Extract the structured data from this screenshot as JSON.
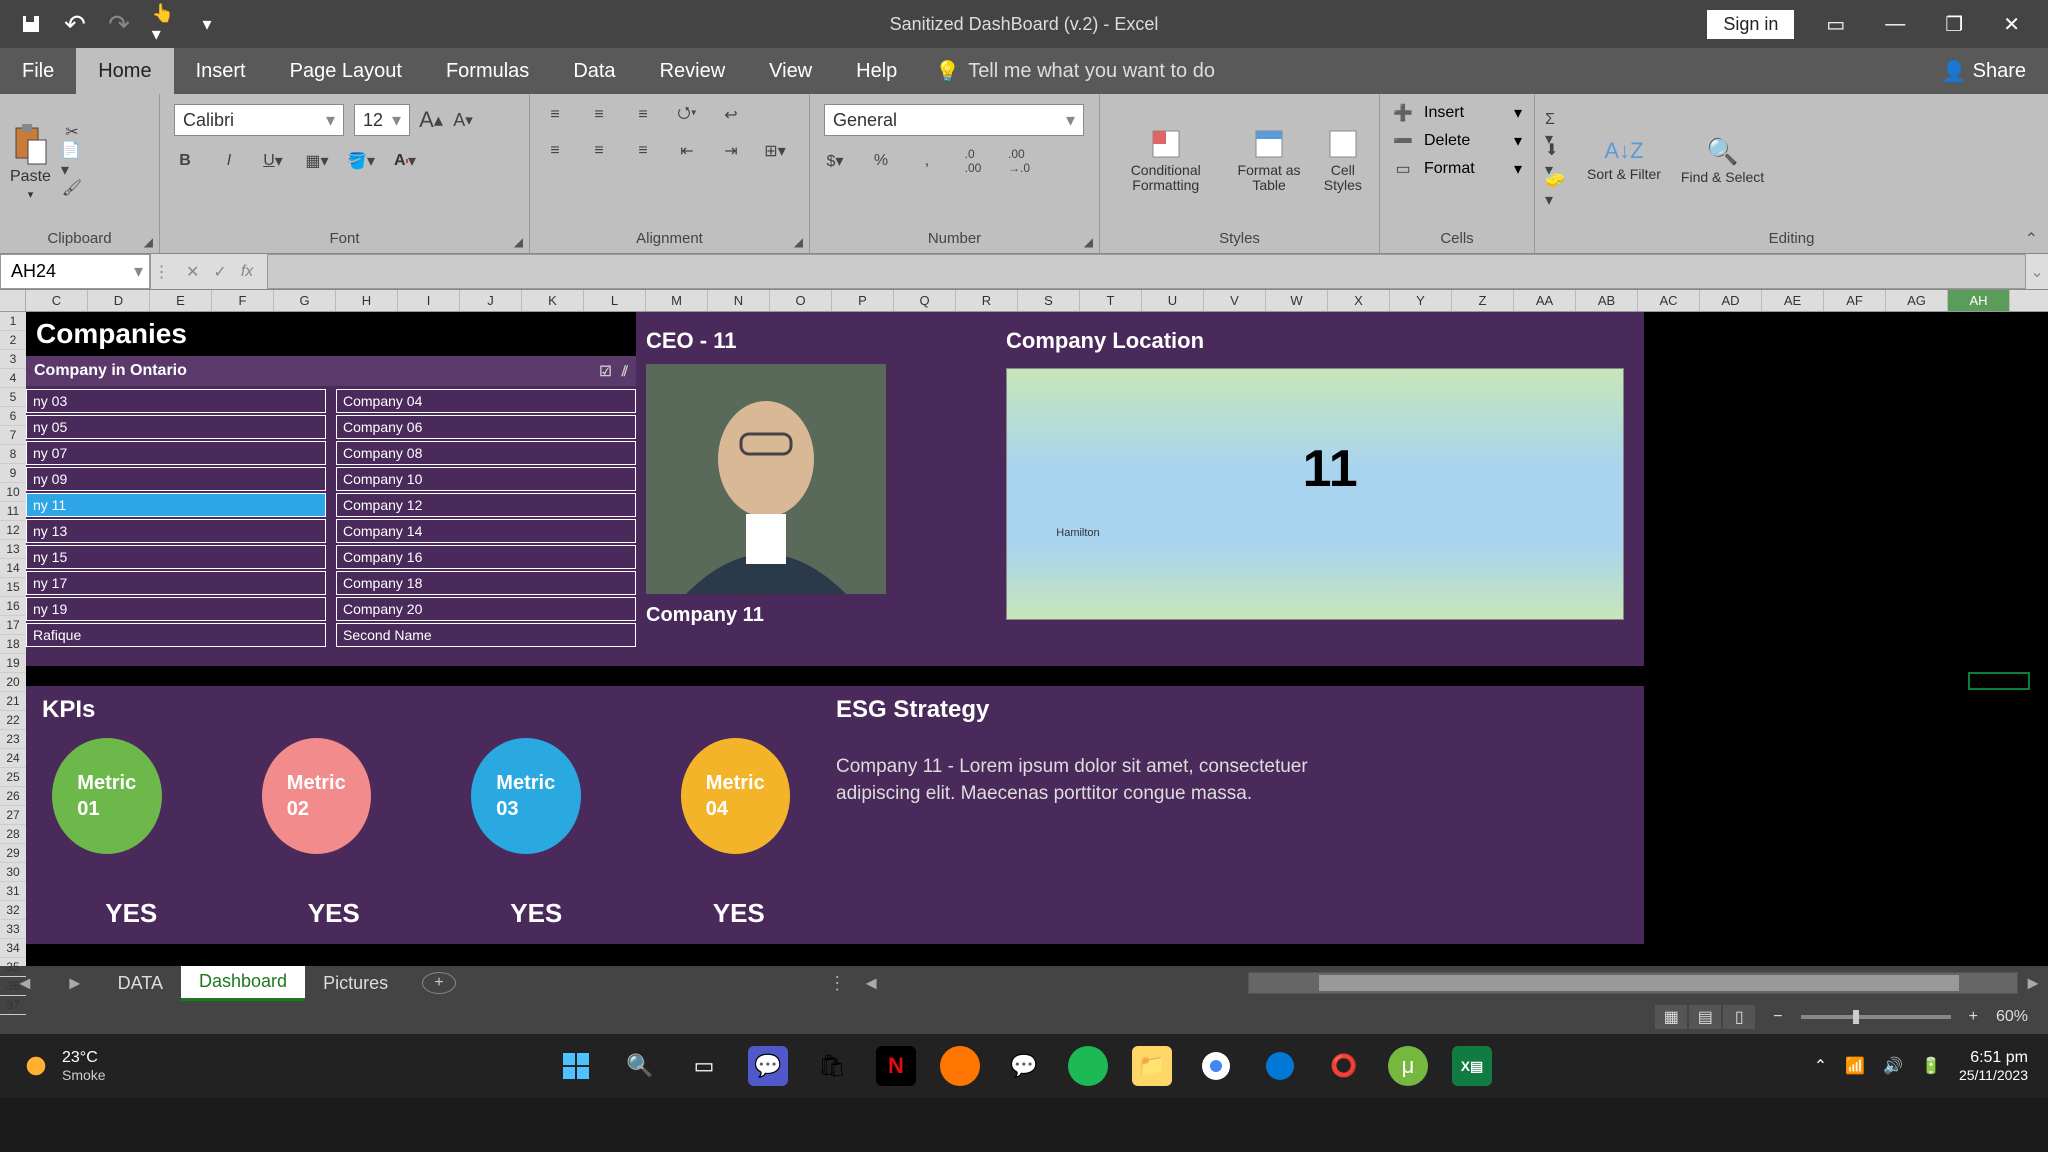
{
  "titlebar": {
    "title": "Sanitized DashBoard (v.2)  -  Excel",
    "signin": "Sign in"
  },
  "menubar": {
    "tabs": [
      "File",
      "Home",
      "Insert",
      "Page Layout",
      "Formulas",
      "Data",
      "Review",
      "View",
      "Help"
    ],
    "active": "Home",
    "tellme": "Tell me what you want to do",
    "share": "Share"
  },
  "ribbon": {
    "clipboard": {
      "label": "Clipboard",
      "paste": "Paste"
    },
    "font": {
      "label": "Font",
      "name": "Calibri",
      "size": "12"
    },
    "alignment": {
      "label": "Alignment"
    },
    "number": {
      "label": "Number",
      "format": "General"
    },
    "styles": {
      "label": "Styles",
      "cond": "Conditional Formatting",
      "fmt": "Format as Table",
      "cell": "Cell Styles"
    },
    "cells": {
      "label": "Cells",
      "insert": "Insert",
      "delete": "Delete",
      "format": "Format"
    },
    "editing": {
      "label": "Editing",
      "sort": "Sort & Filter",
      "find": "Find & Select"
    }
  },
  "fbar": {
    "namebox": "AH24"
  },
  "cols": [
    "C",
    "D",
    "E",
    "F",
    "G",
    "H",
    "I",
    "J",
    "K",
    "L",
    "M",
    "N",
    "O",
    "P",
    "Q",
    "R",
    "S",
    "T",
    "U",
    "V",
    "W",
    "X",
    "Y",
    "Z",
    "AA",
    "AB",
    "AC",
    "AD",
    "AE",
    "AF",
    "AG",
    "AH"
  ],
  "sel_col": "AH",
  "rows": [
    "1",
    "2",
    "3",
    "4",
    "5",
    "6",
    "7",
    "8",
    "9",
    "10",
    "11",
    "12",
    "13",
    "14",
    "15",
    "16",
    "17",
    "18",
    "19",
    "20",
    "21",
    "22",
    "23",
    "24",
    "25",
    "26",
    "27",
    "28",
    "29",
    "30",
    "31",
    "32",
    "33",
    "34",
    "35",
    "36",
    "37"
  ],
  "dash": {
    "companies_title": "Companies",
    "filter_label": "Company in Ontario",
    "slicer_left": [
      "ny 03",
      "ny 05",
      "ny 07",
      "ny 09",
      "ny 11",
      "ny 13",
      "ny 15",
      "ny 17",
      "ny 19",
      "Rafique"
    ],
    "slicer_sel_left": "ny 11",
    "slicer_right": [
      "Company 04",
      "Company 06",
      "Company 08",
      "Company 10",
      "Company 12",
      "Company 14",
      "Company 16",
      "Company 18",
      "Company 20",
      "Second Name"
    ],
    "ceo_label": "CEO -  11",
    "company_name": "Company 11",
    "map_label": "Company Location",
    "map_num": "11",
    "map_city": "Hamilton",
    "kpi_label": "KPIs",
    "kpis": [
      {
        "label": "Metric 01",
        "color": "#6db84a"
      },
      {
        "label": "Metric 02",
        "color": "#f28b8b"
      },
      {
        "label": "Metric 03",
        "color": "#2aa8e0"
      },
      {
        "label": "Metric 04",
        "color": "#f4b42a"
      }
    ],
    "yes": "YES",
    "esg_label": "ESG Strategy",
    "esg_text": "Company 11 - Lorem ipsum dolor sit amet, consectetuer adipiscing elit. Maecenas porttitor congue massa."
  },
  "sheets": {
    "tabs": [
      "DATA",
      "Dashboard",
      "Pictures"
    ],
    "active": "Dashboard"
  },
  "statusbar": {
    "zoom": "60%"
  },
  "taskbar": {
    "temp": "23°C",
    "cond": "Smoke",
    "time": "6:51 pm",
    "date": "25/11/2023"
  }
}
